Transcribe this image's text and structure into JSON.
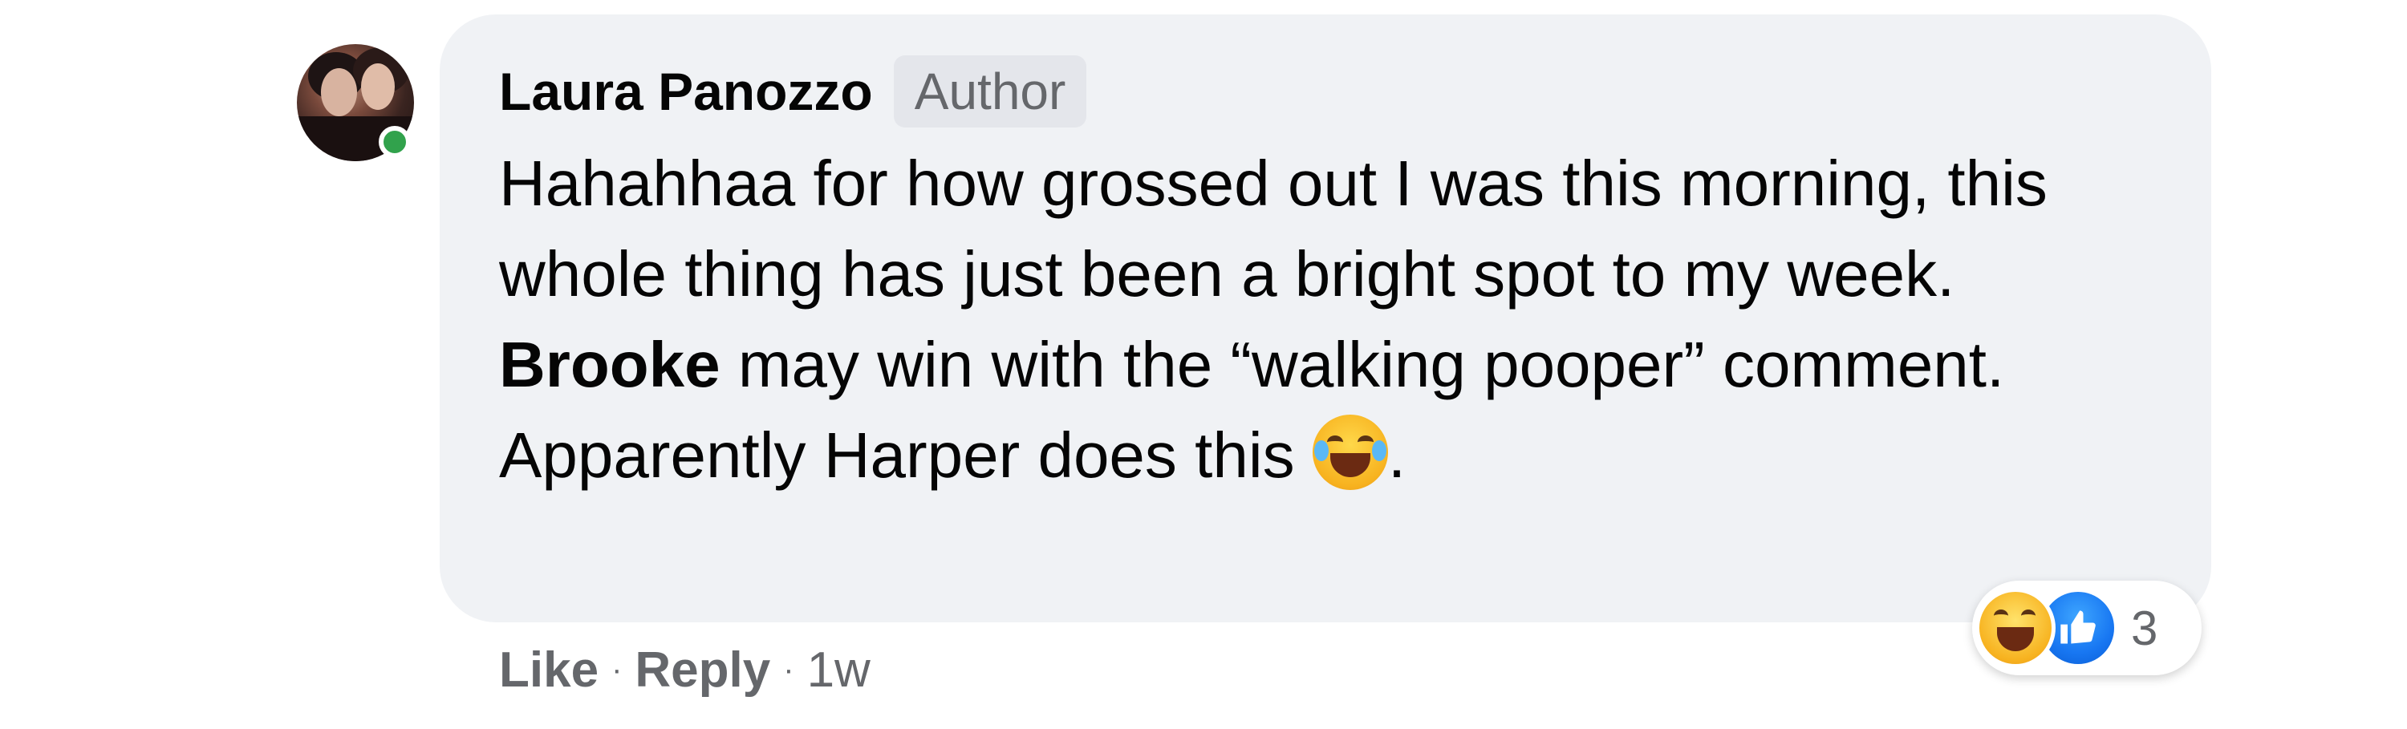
{
  "comment": {
    "author": "Laura Panozzo",
    "badge": "Author",
    "text_parts": {
      "line1": "Hahahhaa for how grossed out I was this morning, this whole thing has just been a bright spot to my week. ",
      "mention": "Brooke",
      "line2": " may win with the “walking pooper” comment. Apparently Harper does this ",
      "trailing": "."
    },
    "inline_emoji": "rolling-on-floor-laughing-emoji"
  },
  "reactions": {
    "icons": [
      "haha-icon",
      "like-icon"
    ],
    "count": "3"
  },
  "actions": {
    "like": "Like",
    "reply": "Reply",
    "separator": "·",
    "time": "1w"
  },
  "colors": {
    "bubble": "#f0f2f5",
    "secondary_text": "#65676b",
    "online": "#31a24c",
    "like_blue": "#1877f2"
  }
}
